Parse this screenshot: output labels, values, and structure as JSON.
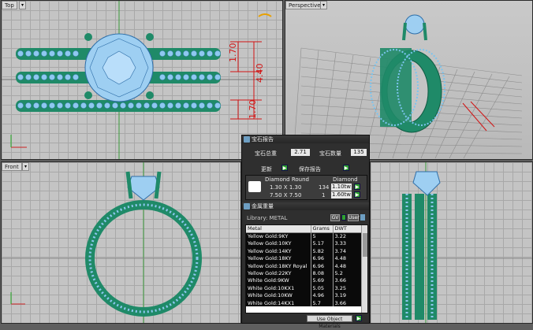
{
  "viewports": {
    "top": {
      "label": "Top",
      "dims": {
        "d1": "1.70",
        "d2": "4.40",
        "d3": "1.70"
      }
    },
    "perspective": {
      "label": "Perspective"
    },
    "front": {
      "label": "Front"
    }
  },
  "panel": {
    "title1": "宝石报告",
    "gem_total_weight_label": "宝石总重",
    "gem_total_weight_value": "2.71",
    "gem_count_label": "宝石数量",
    "gem_count_value": "135",
    "update_label": "更新",
    "save_report_label": "保存报告",
    "diamond_table": {
      "headers": [
        "Diamond Round",
        "Diamond"
      ],
      "rows": [
        {
          "size": "1.30 X 1.30",
          "count": "134",
          "weight": "1.10tw"
        },
        {
          "size": "7.50 X 7.50",
          "count": "1",
          "weight": "1.60tw"
        }
      ]
    },
    "title2": "金属重量",
    "library_label": "Library: METAL",
    "gv_label": "GV",
    "user_label": "User",
    "metal_headers": [
      "Metal",
      "Grams",
      "DWT"
    ],
    "metal_rows": [
      {
        "metal": "Yellow Gold:9KY",
        "grams": "5",
        "dwt": "3.22"
      },
      {
        "metal": "Yellow Gold:10KY",
        "grams": "5.17",
        "dwt": "3.33"
      },
      {
        "metal": "Yellow Gold:14KY",
        "grams": "5.82",
        "dwt": "3.74"
      },
      {
        "metal": "Yellow Gold:18KY",
        "grams": "6.96",
        "dwt": "4.48"
      },
      {
        "metal": "Yellow Gold:18KY Royal",
        "grams": "6.96",
        "dwt": "4.48"
      },
      {
        "metal": "Yellow Gold:22KY",
        "grams": "8.08",
        "dwt": "5.2"
      },
      {
        "metal": "White Gold:9KW",
        "grams": "5.69",
        "dwt": "3.66"
      },
      {
        "metal": "White Gold:10KX1",
        "grams": "5.05",
        "dwt": "3.25"
      },
      {
        "metal": "White Gold:10KW",
        "grams": "4.96",
        "dwt": "3.19"
      },
      {
        "metal": "White Gold:14KX1",
        "grams": "5.7",
        "dwt": "3.66"
      }
    ],
    "use_object_materials_label": "Use Object Materials"
  },
  "colors": {
    "metal": "#1f8a68",
    "gem": "#8ec8f0",
    "dims": "#d21414"
  }
}
